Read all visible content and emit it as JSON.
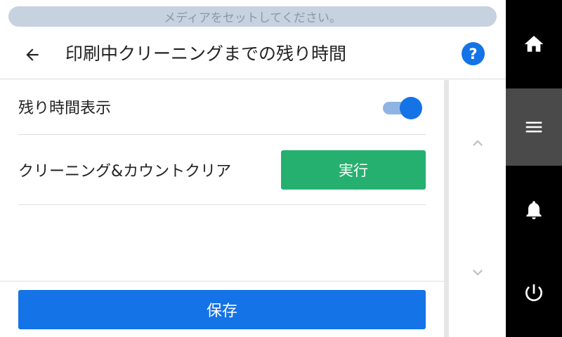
{
  "banner": {
    "message": "メディアをセットしてください。"
  },
  "header": {
    "title": "印刷中クリーニングまでの残り時間",
    "help_label": "?"
  },
  "settings": {
    "show_remaining": {
      "label": "残り時間表示",
      "value": "on"
    },
    "clear_count": {
      "label": "クリーニング&カウントクリア",
      "button_label": "実行"
    }
  },
  "footer": {
    "save_label": "保存"
  },
  "nav": {
    "items": [
      {
        "icon": "home-icon",
        "active": false
      },
      {
        "icon": "menu-icon",
        "active": true
      },
      {
        "icon": "bell-icon",
        "active": false
      },
      {
        "icon": "power-icon",
        "active": false
      }
    ]
  },
  "colors": {
    "accent": "#1473e6",
    "run_button": "#25b06f",
    "banner_bg": "#c7d2e0",
    "nav_bg": "#000000"
  }
}
